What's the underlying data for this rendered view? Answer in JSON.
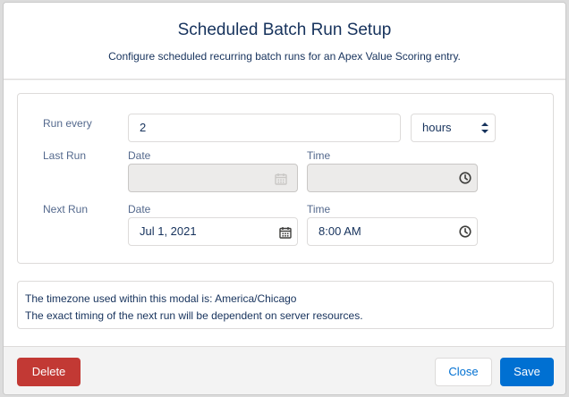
{
  "modal": {
    "title": "Scheduled Batch Run Setup",
    "subtitle": "Configure scheduled recurring batch runs for an Apex Value Scoring entry."
  },
  "form": {
    "run_every_label": "Run every",
    "run_every_value": "2",
    "interval_unit": "hours",
    "last_run_label": "Last Run",
    "last_run_date_label": "Date",
    "last_run_time_label": "Time",
    "last_run_date_value": "",
    "last_run_time_value": "",
    "next_run_label": "Next Run",
    "next_run_date_label": "Date",
    "next_run_time_label": "Time",
    "next_run_date_value": "Jul 1, 2021",
    "next_run_time_value": "8:00 AM"
  },
  "info": {
    "line1": "The timezone used within this modal is: America/Chicago",
    "line2": "The exact timing of the next run will be dependent on server resources."
  },
  "footer": {
    "delete_label": "Delete",
    "close_label": "Close",
    "save_label": "Save"
  },
  "colors": {
    "brand": "#0070d2",
    "destructive": "#c23934",
    "heading": "#16325c"
  },
  "icons": [
    "calendar-icon",
    "clock-icon",
    "sort-arrows-icon"
  ]
}
